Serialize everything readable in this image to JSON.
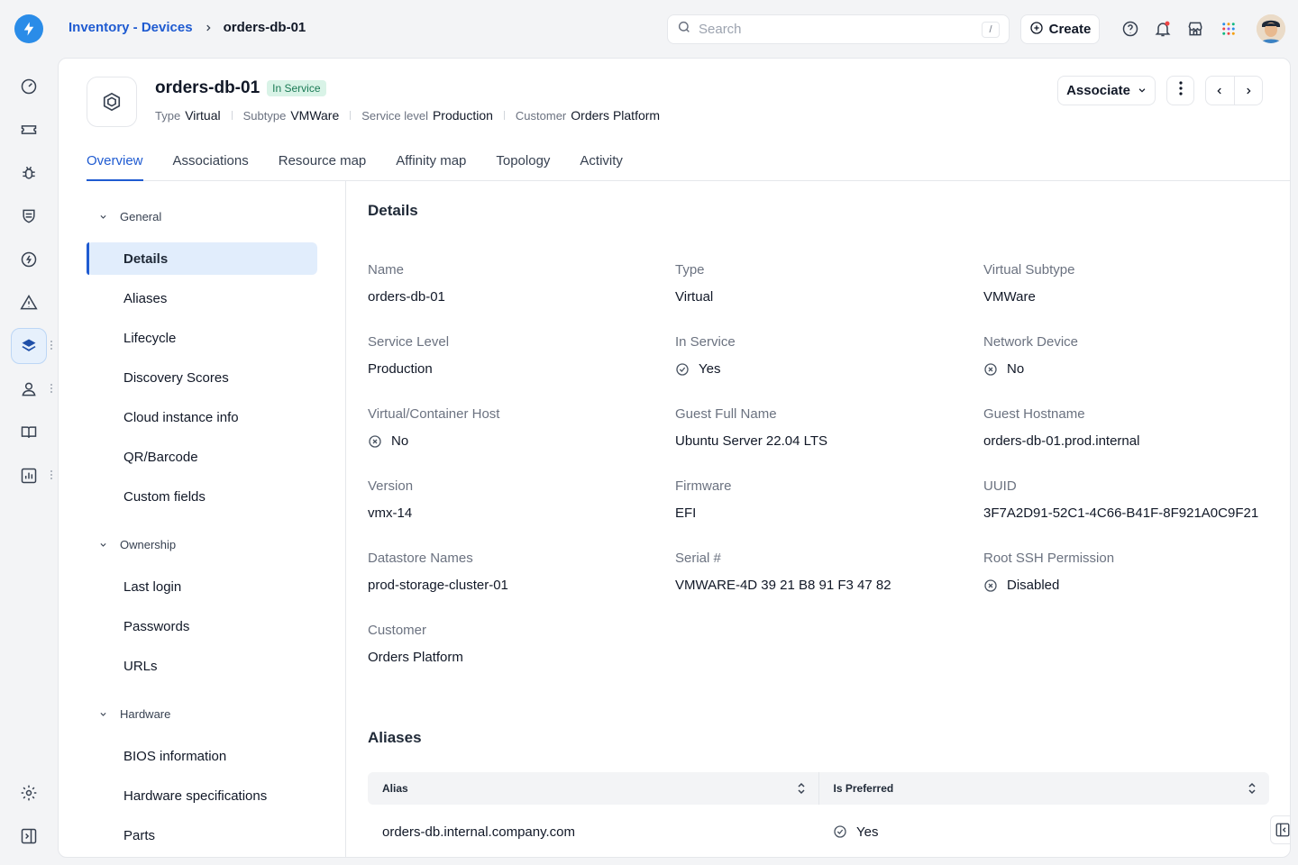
{
  "breadcrumb": {
    "parent": "Inventory - Devices",
    "current": "orders-db-01"
  },
  "search": {
    "placeholder": "Search",
    "shortcut": "/"
  },
  "header": {
    "create_label": "Create"
  },
  "device": {
    "name": "orders-db-01",
    "status": "In Service",
    "meta": [
      {
        "label": "Type",
        "value": "Virtual"
      },
      {
        "label": "Subtype",
        "value": "VMWare"
      },
      {
        "label": "Service level",
        "value": "Production"
      },
      {
        "label": "Customer",
        "value": "Orders Platform"
      }
    ],
    "associate_label": "Associate"
  },
  "tabs": [
    "Overview",
    "Associations",
    "Resource map",
    "Affinity map",
    "Topology",
    "Activity"
  ],
  "section_nav": {
    "groups": [
      {
        "label": "General",
        "items": [
          "Details",
          "Aliases",
          "Lifecycle",
          "Discovery Scores",
          "Cloud instance info",
          "QR/Barcode",
          "Custom fields"
        ]
      },
      {
        "label": "Ownership",
        "items": [
          "Last login",
          "Passwords",
          "URLs"
        ]
      },
      {
        "label": "Hardware",
        "items": [
          "BIOS information",
          "Hardware specifications",
          "Parts"
        ]
      }
    ],
    "active": "Details"
  },
  "details": {
    "title": "Details",
    "fields": [
      {
        "label": "Name",
        "value": "orders-db-01",
        "icon": ""
      },
      {
        "label": "Type",
        "value": "Virtual",
        "icon": ""
      },
      {
        "label": "Virtual Subtype",
        "value": "VMWare",
        "icon": ""
      },
      {
        "label": "Service Level",
        "value": "Production",
        "icon": ""
      },
      {
        "label": "In Service",
        "value": "Yes",
        "icon": "check-circle-icon"
      },
      {
        "label": "Network Device",
        "value": "No",
        "icon": "x-circle-icon"
      },
      {
        "label": "Virtual/Container Host",
        "value": "No",
        "icon": "x-circle-icon"
      },
      {
        "label": "Guest Full Name",
        "value": "Ubuntu Server 22.04 LTS",
        "icon": ""
      },
      {
        "label": "Guest Hostname",
        "value": "orders-db-01.prod.internal",
        "icon": ""
      },
      {
        "label": "Version",
        "value": "vmx-14",
        "icon": ""
      },
      {
        "label": "Firmware",
        "value": "EFI",
        "icon": ""
      },
      {
        "label": "UUID",
        "value": "3F7A2D91-52C1-4C66-B41F-8F921A0C9F21",
        "icon": ""
      },
      {
        "label": "Datastore Names",
        "value": "prod-storage-cluster-01",
        "icon": ""
      },
      {
        "label": "Serial #",
        "value": "VMWARE-4D 39 21 B8 91 F3 47 82",
        "icon": ""
      },
      {
        "label": "Root SSH Permission",
        "value": "Disabled",
        "icon": "x-circle-icon"
      },
      {
        "label": "Customer",
        "value": "Orders Platform",
        "icon": ""
      }
    ]
  },
  "aliases": {
    "title": "Aliases",
    "columns": [
      "Alias",
      "Is Preferred"
    ],
    "rows": [
      {
        "alias": "orders-db.internal.company.com",
        "preferred": "Yes"
      }
    ]
  },
  "colors": {
    "accent": "#1f5bd1",
    "badge_bg": "#d9f3e7",
    "badge_text": "#1b7a55",
    "logo": "#2a8ce8"
  }
}
